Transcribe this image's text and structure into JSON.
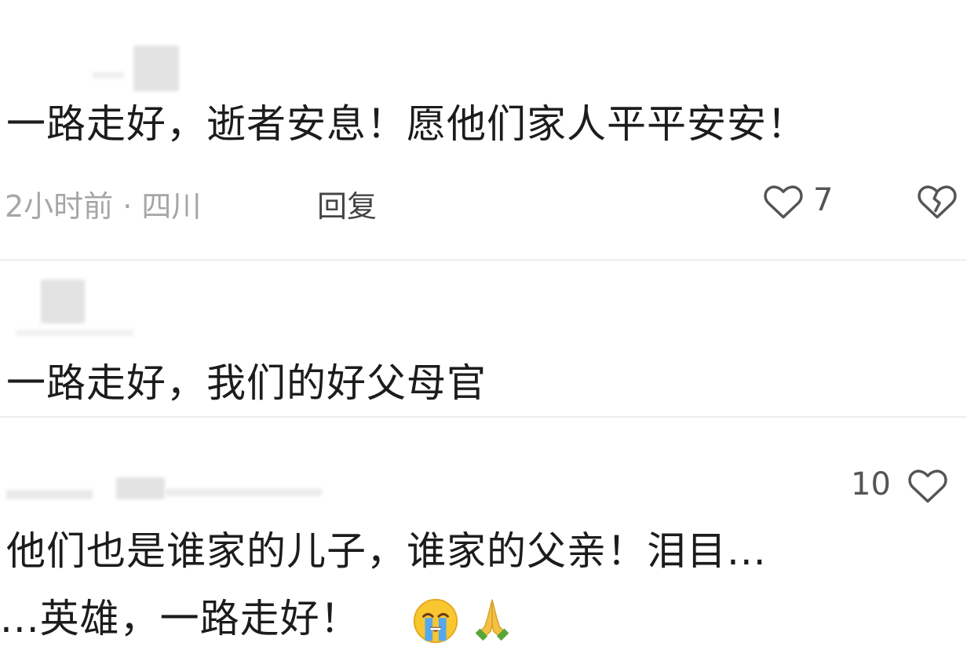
{
  "comments": [
    {
      "text": "一路走好，逝者安息！愿他们家人平平安安！",
      "time_location": "2小时前 · 四川",
      "reply_label": "回复",
      "like_count": "7"
    },
    {
      "text": "一路走好，我们的好父母官"
    },
    {
      "like_count": "10",
      "text_line1": "他们也是谁家的儿子，谁家的父亲！泪目...",
      "text_line2": "...英雄，一路走好！"
    }
  ],
  "icons": {
    "like": "heart-outline-icon",
    "dislike": "broken-heart-icon",
    "emoji_crying": "loudly-crying-face-emoji",
    "emoji_pray": "folded-hands-emoji"
  },
  "colors": {
    "text": "#1c1c1c",
    "meta": "#a6a6a6",
    "icon": "#555555"
  }
}
